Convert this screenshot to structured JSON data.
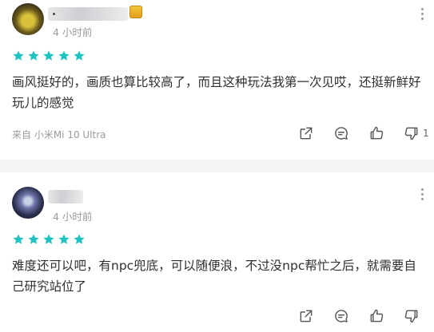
{
  "reviews": [
    {
      "time": "4 小时前",
      "rating": 5,
      "content": "画风挺好的，画质也算比较高了，而且这种玩法我第一次见哎，还挺新鲜好玩儿的感觉",
      "device": "来自 小米Mi 10 Ultra",
      "dislike_count": "1"
    },
    {
      "time": "4 小时前",
      "rating": 5,
      "content": "难度还可以吧，有npc兜底，可以随便浪，不过没npc帮忙之后，就需要自己研究站位了"
    }
  ],
  "colors": {
    "star": "#1fc1c1",
    "divider": "#f4f5f7",
    "muted": "#9a9a9a"
  },
  "icons": {
    "share": "share-icon",
    "comment": "comment-icon",
    "like": "thumbs-up-icon",
    "dislike": "thumbs-down-icon",
    "more": "more-vertical-icon"
  }
}
